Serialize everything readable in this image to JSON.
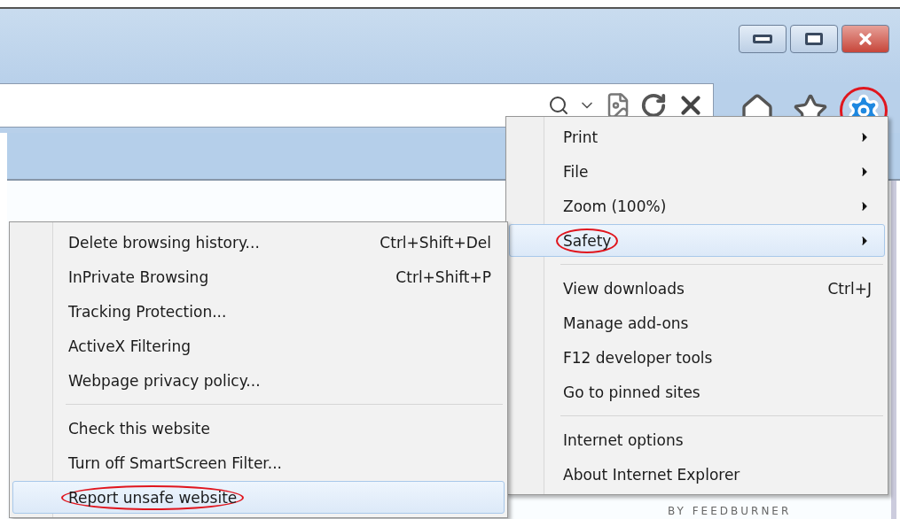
{
  "page_footer_text": "BY FEEDBURNER",
  "tools_menu": {
    "groups": [
      [
        {
          "label": "Print",
          "has_submenu": true,
          "selected": false,
          "circled": false
        },
        {
          "label": "File",
          "has_submenu": true,
          "selected": false,
          "circled": false
        },
        {
          "label": "Zoom (100%)",
          "has_submenu": true,
          "selected": false,
          "circled": false
        },
        {
          "label": "Safety",
          "has_submenu": true,
          "selected": true,
          "circled": true
        }
      ],
      [
        {
          "label": "View downloads",
          "shortcut": "Ctrl+J",
          "has_submenu": false,
          "selected": false,
          "circled": false
        },
        {
          "label": "Manage add-ons",
          "has_submenu": false,
          "selected": false,
          "circled": false
        },
        {
          "label": "F12 developer tools",
          "has_submenu": false,
          "selected": false,
          "circled": false
        },
        {
          "label": "Go to pinned sites",
          "has_submenu": false,
          "selected": false,
          "circled": false
        }
      ],
      [
        {
          "label": "Internet options",
          "has_submenu": false,
          "selected": false,
          "circled": false
        },
        {
          "label": "About Internet Explorer",
          "has_submenu": false,
          "selected": false,
          "circled": false
        }
      ]
    ]
  },
  "safety_submenu": {
    "groups": [
      [
        {
          "label": "Delete browsing history...",
          "shortcut": "Ctrl+Shift+Del",
          "selected": false,
          "circled": false
        },
        {
          "label": "InPrivate Browsing",
          "shortcut": "Ctrl+Shift+P",
          "selected": false,
          "circled": false
        },
        {
          "label": "Tracking Protection...",
          "selected": false,
          "circled": false
        },
        {
          "label": "ActiveX Filtering",
          "selected": false,
          "circled": false
        },
        {
          "label": "Webpage privacy policy...",
          "selected": false,
          "circled": false
        }
      ],
      [
        {
          "label": "Check this website",
          "selected": false,
          "circled": false
        },
        {
          "label": "Turn off SmartScreen Filter...",
          "selected": false,
          "circled": false
        },
        {
          "label": "Report unsafe website",
          "selected": true,
          "circled": true
        }
      ]
    ]
  },
  "tools_button": {
    "circled": true
  }
}
